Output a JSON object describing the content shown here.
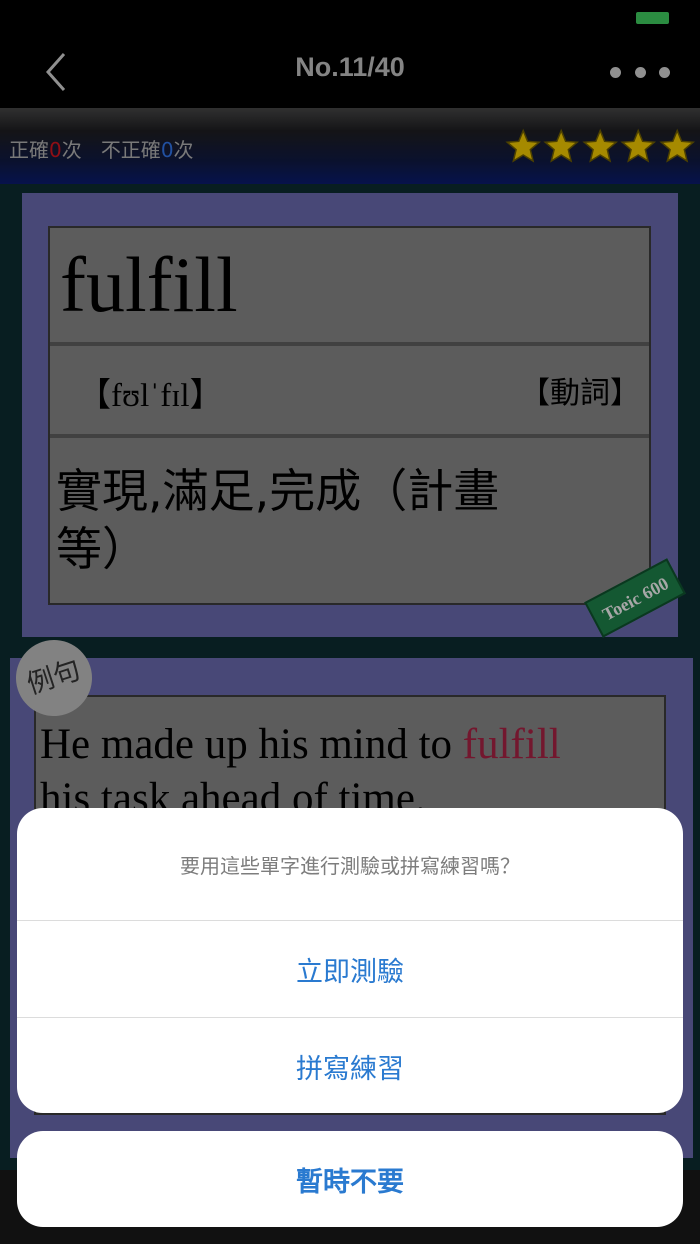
{
  "nav": {
    "title": "No.11/40"
  },
  "stats": {
    "correct_label": "正確",
    "correct_count": "0",
    "incorrect_label": "不正確",
    "incorrect_count": "0",
    "unit": "次"
  },
  "rating": {
    "stars": 5,
    "max": 5
  },
  "word_card": {
    "word": "fulfill",
    "phonetic": "【fʊlˈfɪl】",
    "part_of_speech": "【動詞】",
    "meaning": "實現,滿足,完成（計畫等）",
    "badge": "Toeic 600"
  },
  "example": {
    "badge": "例句",
    "sentence_before": "He made up his mind to ",
    "sentence_highlight": "fulfill",
    "sentence_after": "his task ahead of time."
  },
  "action_sheet": {
    "message": "要用這些單字進行測驗或拼寫練習嗎？",
    "actions": [
      "立即測驗",
      "拼寫練習"
    ],
    "cancel": "暫時不要"
  },
  "colors": {
    "accent": "#2a7ad0",
    "highlight": "#a02040",
    "star": "#e6c000"
  }
}
